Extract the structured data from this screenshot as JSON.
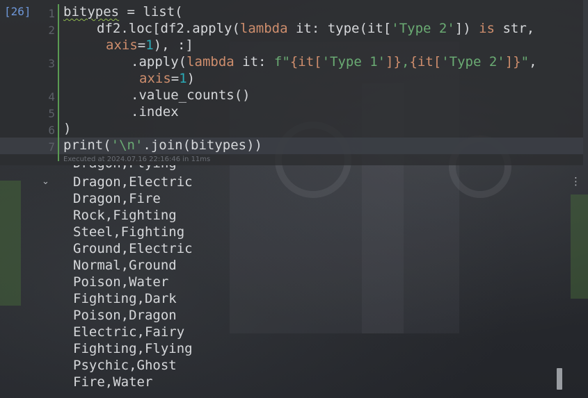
{
  "cell": {
    "execution_count": "[26]",
    "line_numbers": [
      "1",
      "2",
      "3",
      "4",
      "5",
      "6",
      "7"
    ],
    "execution_meta": "Executed at 2024.07.16 22:16:46 in 11ms",
    "code": {
      "l1_var": "bitypes",
      "l1_rest": " = list(",
      "l2_a": "df2.loc[df2.apply(",
      "l2_lambda": "lambda",
      "l2_b": " it: type(it[",
      "l2_str": "'Type 2'",
      "l2_c": "]) ",
      "l2_is": "is",
      "l2_d": " str,",
      "l2b_param": "axis",
      "l2b_eq": "=",
      "l2b_num": "1",
      "l2b_rest": "), :]",
      "l3_a": ".apply(",
      "l3_lambda": "lambda",
      "l3_b": " it: ",
      "l3_f": "f\"",
      "l3_c": "{it[",
      "l3_s1": "'Type 1'",
      "l3_d": "]}",
      "l3_comma": ",",
      "l3_e": "{it[",
      "l3_s2": "'Type 2'",
      "l3_g": "]}",
      "l3_q": "\"",
      "l3_h": ",",
      "l3b_param": "axis",
      "l3b_eq": "=",
      "l3b_num": "1",
      "l3b_rest": ")",
      "l4": ".value_counts()",
      "l5": ".index",
      "l6": ")",
      "l7_a": "print(",
      "l7_str": "'\\n'",
      "l7_b": ".join(bitypes))"
    }
  },
  "output": {
    "toggle_icon": "chevron-down",
    "menu_icon": "vertical-ellipsis",
    "clipped_line": "Dragon,Flying",
    "lines": [
      "Dragon,Electric",
      "Dragon,Fire",
      "Rock,Fighting",
      "Steel,Fighting",
      "Ground,Electric",
      "Normal,Ground",
      "Poison,Water",
      "Fighting,Dark",
      "Poison,Dragon",
      "Electric,Fairy",
      "Fighting,Flying",
      "Psychic,Ghost",
      "Fire,Water"
    ]
  },
  "colors": {
    "keyword": "#cf8e6d",
    "string": "#6aab73",
    "number": "#2aacb8",
    "execution_count": "#6e97d8",
    "gutter_bar": "#5a9a52"
  }
}
